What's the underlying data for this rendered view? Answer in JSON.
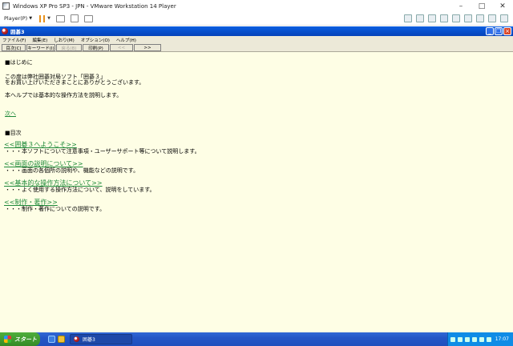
{
  "vm": {
    "title": "Windows XP Pro SP3 - JPN - VMware Workstation 14 Player",
    "player_label": "Player(P)"
  },
  "app": {
    "title": "囲碁3",
    "menu": [
      "ファイル(F)",
      "編集(E)",
      "しおり(M)",
      "オプション(O)",
      "ヘルプ(H)"
    ],
    "buttons": [
      {
        "label": "目次(C)",
        "enabled": true
      },
      {
        "label": "キーワード(I)",
        "enabled": true
      },
      {
        "label": "戻る(B)",
        "enabled": false
      },
      {
        "label": "印刷(P)",
        "enabled": true
      },
      {
        "label": "<<",
        "enabled": false
      },
      {
        "label": ">>",
        "enabled": true
      }
    ]
  },
  "content": {
    "heading_intro": "■はじめに",
    "intro_line1": "この度は弊社囲碁対局ソフト「囲碁３」",
    "intro_line2": "をお買い上げいただきまことにありがとうございます。",
    "intro_line3": "本ヘルプでは基本的な操作方法を説明します。",
    "next_link": "次へ",
    "heading_toc": "■目次",
    "toc": [
      {
        "link": "<<囲碁３へようこそ>>",
        "desc": "・・・本ソフトについて注意事項・ユーザーサポート等について説明します。"
      },
      {
        "link": "<<画面の説明について>>",
        "desc": "・・・画面の各個所の説明や、機能などの説明です。"
      },
      {
        "link": "<<基本的な操作方法について>>",
        "desc": "・・・よく使用する操作方法について、説明をしています。"
      },
      {
        "link": "<<制作・著作>>",
        "desc": "・・・制作・著作についての説明です。"
      }
    ]
  },
  "taskbar": {
    "start_label": "スタート",
    "task_label": "囲碁3",
    "clock": "17:07"
  }
}
